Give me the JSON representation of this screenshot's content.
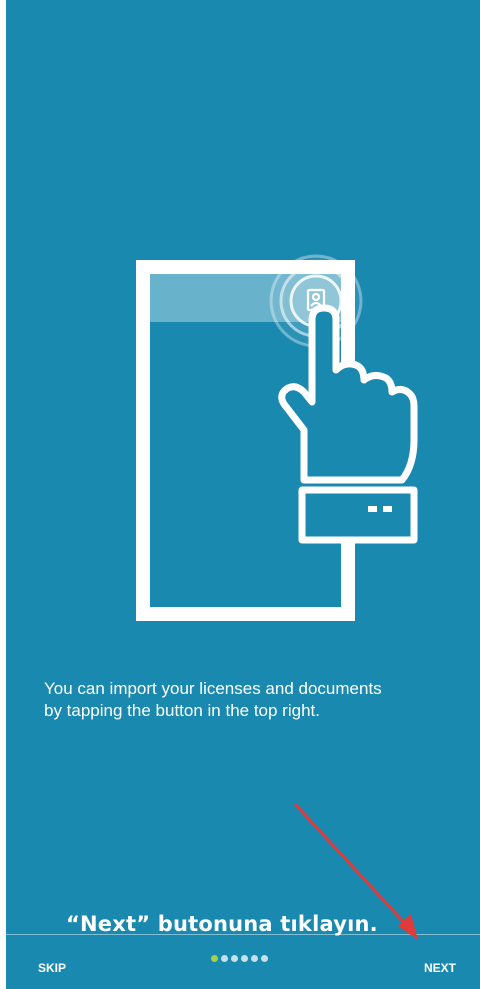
{
  "onboarding": {
    "message": "You can import your licenses and documents\nby tapping the button in the top right.",
    "annotation": "“Next” butonuna tıklayın.",
    "skip_label": "SKIP",
    "next_label": "NEXT",
    "page_indicator": {
      "total": 6,
      "active_index": 0
    }
  },
  "colors": {
    "background": "#1a89b0",
    "accent_dot": "#a6cf4a",
    "annotation_arrow": "#e03a3a"
  },
  "icons": {
    "illustration": "phone-tap-hand-illustration",
    "import_button": "person-document-icon",
    "arrow": "red-arrow-annotation"
  }
}
